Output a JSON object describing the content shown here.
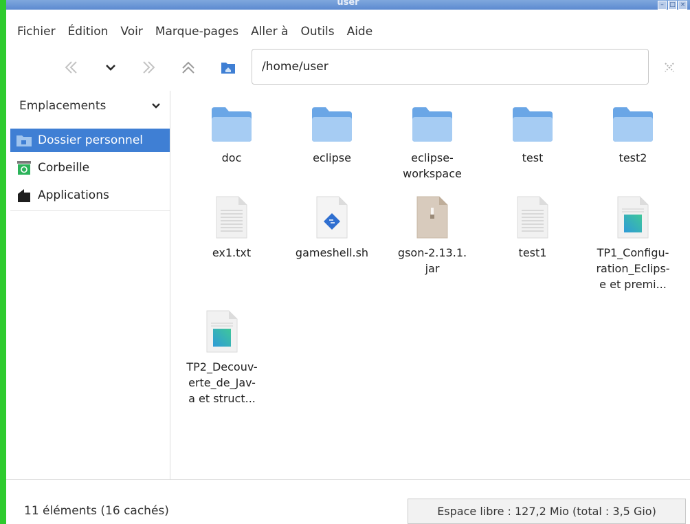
{
  "window": {
    "title": "user"
  },
  "menu": [
    "Fichier",
    "Édition",
    "Voir",
    "Marque-pages",
    "Aller à",
    "Outils",
    "Aide"
  ],
  "toolbar": {
    "path": "/home/user"
  },
  "sidebar": {
    "header": "Emplacements",
    "items": [
      {
        "label": "Dossier personnel",
        "icon": "home-folder-icon",
        "selected": true
      },
      {
        "label": "Corbeille",
        "icon": "trash-icon",
        "selected": false
      },
      {
        "label": "Applications",
        "icon": "applications-icon",
        "selected": false
      }
    ]
  },
  "files": [
    {
      "name": "doc",
      "type": "folder"
    },
    {
      "name": "eclipse",
      "type": "folder"
    },
    {
      "name": "eclipse-\nworkspace",
      "type": "folder"
    },
    {
      "name": "test",
      "type": "folder"
    },
    {
      "name": "test2",
      "type": "folder"
    },
    {
      "name": "ex1.txt",
      "type": "text"
    },
    {
      "name": "gameshell.sh",
      "type": "script"
    },
    {
      "name": "gson-2.13.1.\njar",
      "type": "archive"
    },
    {
      "name": "test1",
      "type": "text"
    },
    {
      "name": "TP1_Configu-\nration_Eclips-\ne et premi...",
      "type": "document"
    },
    {
      "name": "TP2_Decouv-\nerte_de_Jav-\na et struct...",
      "type": "document"
    }
  ],
  "status": {
    "count": "11 éléments (16 cachés)",
    "free_space": "Espace libre : 127,2 Mio (total : 3,5 Gio)"
  },
  "colors": {
    "accent": "#3f7fd4",
    "folder": "#6aa6e6",
    "green_border": "#2ecb2e"
  }
}
